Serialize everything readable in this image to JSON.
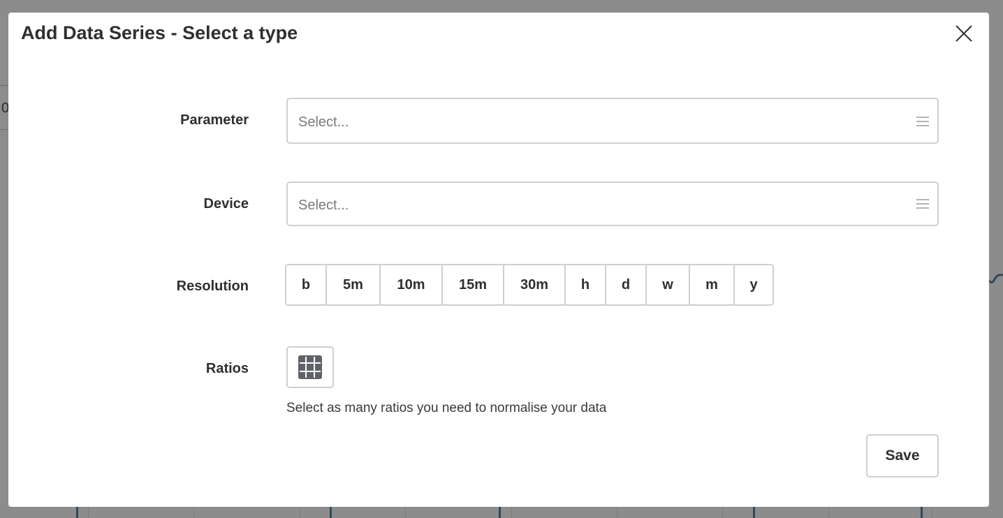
{
  "modal": {
    "title": "Add Data Series - Select a type"
  },
  "background": {
    "partial_text": "0"
  },
  "fields": {
    "parameter": {
      "label": "Parameter",
      "placeholder": "Select..."
    },
    "device": {
      "label": "Device",
      "placeholder": "Select..."
    },
    "resolution": {
      "label": "Resolution",
      "options": [
        "b",
        "5m",
        "10m",
        "15m",
        "30m",
        "h",
        "d",
        "w",
        "m",
        "y"
      ]
    },
    "ratios": {
      "label": "Ratios",
      "help_text": "Select as many ratios you need to normalise your data"
    }
  },
  "actions": {
    "save_label": "Save"
  },
  "icons": {
    "close": "close-icon",
    "menu": "hamburger-icon",
    "ratios": "grid-icon"
  }
}
